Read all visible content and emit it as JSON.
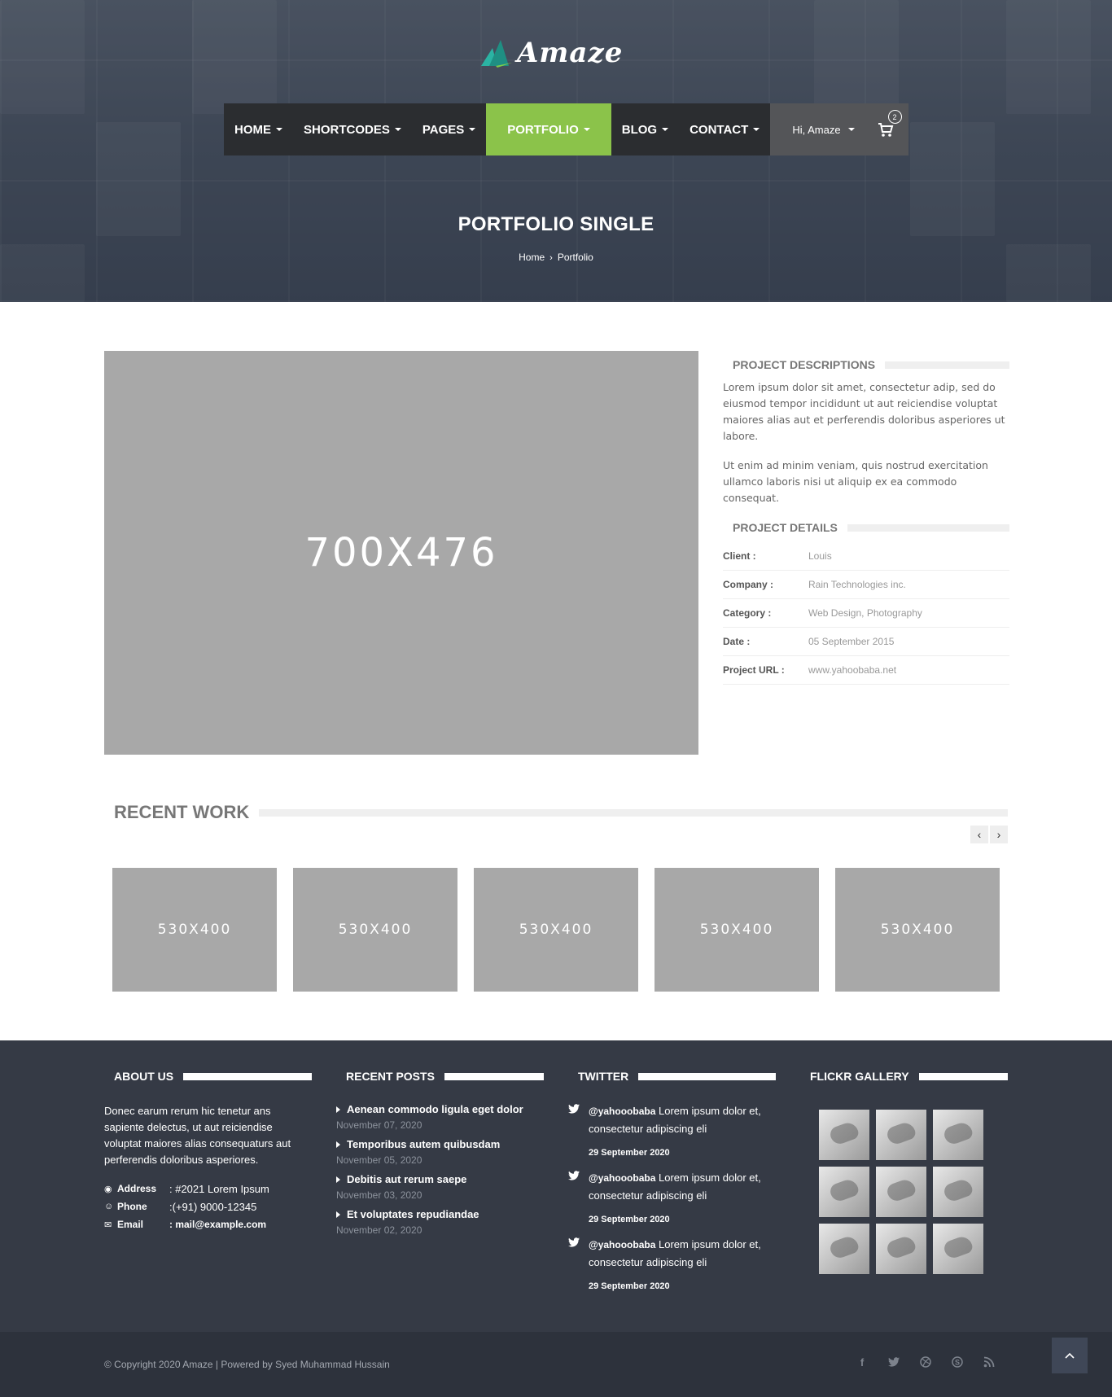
{
  "brand": {
    "logo_text": "Amaze",
    "accent": "#8bc34a"
  },
  "nav": {
    "items": [
      {
        "label": "HOME"
      },
      {
        "label": "SHORTCODES"
      },
      {
        "label": "PAGES"
      },
      {
        "label": "PORTFOLIO",
        "active": true
      },
      {
        "label": "BLOG"
      },
      {
        "label": "CONTACT"
      }
    ],
    "user_greeting": "Hi, Amaze",
    "cart_count": "2"
  },
  "hero": {
    "title": "PORTFOLIO SINGLE",
    "breadcrumb": {
      "home": "Home",
      "separator": "›",
      "current": "Portfolio"
    }
  },
  "project": {
    "image_label": "700X476",
    "descriptions_title": "PROJECT DESCRIPTIONS",
    "description_p1": "Lorem ipsum dolor sit amet, consectetur adip, sed do eiusmod tempor incididunt ut aut reiciendise voluptat maiores alias aut et perferendis doloribus asperiores ut labore.",
    "description_p2": "Ut enim ad minim veniam, quis nostrud exercitation ullamco laboris nisi ut aliquip ex ea commodo consequat.",
    "details_title": "PROJECT DETAILS",
    "details": [
      {
        "key": "Client :",
        "value": "Louis"
      },
      {
        "key": "Company :",
        "value": "Rain Technologies inc."
      },
      {
        "key": "Category :",
        "value": "Web Design, Photography"
      },
      {
        "key": "Date :",
        "value": "05 September 2015"
      },
      {
        "key": "Project URL :",
        "value": "www.yahoobaba.net"
      }
    ]
  },
  "recent_work": {
    "title": "RECENT WORK",
    "prev_label": "‹",
    "next_label": "›",
    "items": [
      "530X400",
      "530X400",
      "530X400",
      "530X400",
      "530X400"
    ]
  },
  "footer": {
    "about": {
      "title": "ABOUT US",
      "text": "Donec earum rerum hic tenetur ans sapiente delectus, ut aut reiciendise voluptat maiores alias consequaturs aut perferendis doloribus asperiores.",
      "address_label": "Address",
      "address": ": #2021 Lorem Ipsum",
      "phone_label": "Phone",
      "phone": ":(+91) 9000-12345",
      "email_label": "Email",
      "email": ": mail@example.com"
    },
    "recent_posts": {
      "title": "RECENT POSTS",
      "posts": [
        {
          "title": "Aenean commodo ligula eget dolor",
          "date": "November 07, 2020"
        },
        {
          "title": "Temporibus autem quibusdam",
          "date": "November 05, 2020"
        },
        {
          "title": "Debitis aut rerum saepe",
          "date": "November 03, 2020"
        },
        {
          "title": "Et voluptates repudiandae",
          "date": "November 02, 2020"
        }
      ]
    },
    "twitter": {
      "title": "TWITTER",
      "tweets": [
        {
          "handle": "@yahooobaba",
          "text": " Lorem ipsum dolor et, consectetur adipiscing eli",
          "date": "29 September 2020"
        },
        {
          "handle": "@yahooobaba",
          "text": " Lorem ipsum dolor et, consectetur adipiscing eli",
          "date": "29 September 2020"
        },
        {
          "handle": "@yahooobaba",
          "text": " Lorem ipsum dolor et, consectetur adipiscing eli",
          "date": "29 September 2020"
        }
      ]
    },
    "flickr": {
      "title": "FLICKR GALLERY"
    },
    "copyright": "© Copyright 2020 Amaze | Powered by Syed Muhammad Hussain",
    "social_icons": [
      "facebook-icon",
      "twitter-icon",
      "dribbble-icon",
      "skype-icon",
      "rss-icon"
    ]
  }
}
